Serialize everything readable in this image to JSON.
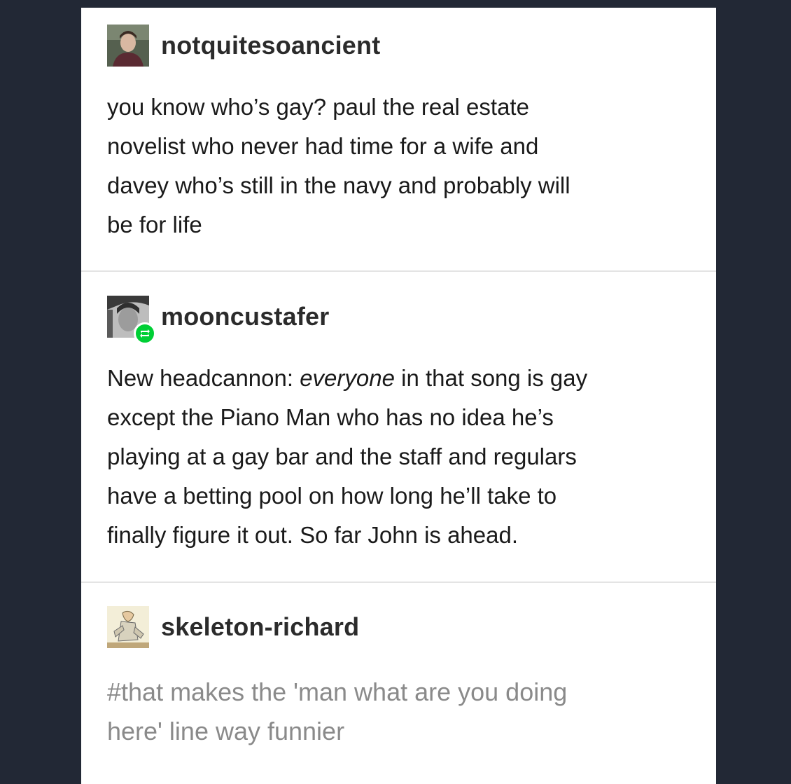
{
  "posts": [
    {
      "username": "notquitesoancient",
      "avatar_icon": "person-avatar-icon",
      "lines": [
        "you know who’s gay? paul the real estate",
        "novelist who never had time for a wife and",
        "davey who’s still in the navy and probably will",
        "be for life"
      ]
    },
    {
      "username": "mooncustafer",
      "avatar_icon": "person-avatar-icon",
      "badge_icon": "reblog-icon",
      "line1_before": "New headcannon: ",
      "line1_emphasis": "everyone",
      "line1_after": " in that song is gay",
      "lines": [
        "except the Piano Man who has no idea he’s",
        "playing at a gay bar and the staff and regulars",
        "have a betting pool on how long he’ll take to",
        "finally figure it out. So far John is ahead."
      ]
    },
    {
      "username": "skeleton-richard",
      "avatar_icon": "drawing-avatar-icon",
      "tag_lines": [
        "#that makes the 'man what are you doing",
        "here' line way funnier"
      ]
    }
  ],
  "colors": {
    "background": "#222835",
    "card": "#ffffff",
    "reblog_badge": "#00cf35",
    "tags": "#8a8a8a"
  }
}
